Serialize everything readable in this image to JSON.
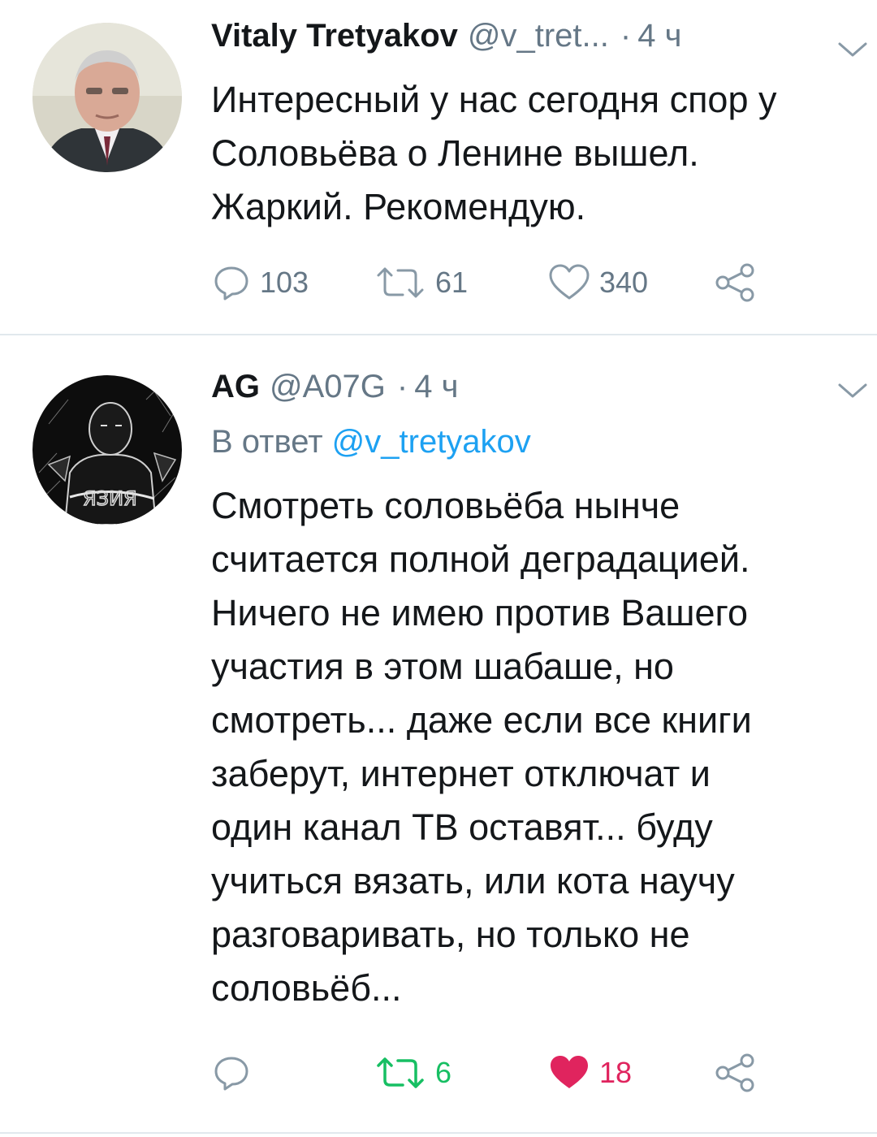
{
  "colors": {
    "text": "#14171a",
    "secondary": "#657786",
    "link": "#1da1f2",
    "retweet_active": "#17bf63",
    "like_active": "#e0245e",
    "divider": "#e1e8ed"
  },
  "tweets": [
    {
      "author_name": "Vitaly Tretyakov",
      "handle": "@v_tret...",
      "dot": "·",
      "time": "4 ч",
      "body_lines": [
        "Интересный у нас сегодня спор у",
        "Соловьёва о Ленине вышел.",
        "Жаркий. Рекомендую."
      ],
      "replies": "103",
      "retweets": "61",
      "likes": "340",
      "retweeted": false,
      "liked": false,
      "icons": [
        "reply-icon",
        "retweet-icon",
        "heart-icon",
        "share-icon",
        "chevron-down-icon"
      ]
    },
    {
      "author_name": "AG",
      "handle": "@A07G",
      "dot": "·",
      "time": "4 ч",
      "reply_prefix": "В ответ",
      "reply_handle": "@v_tretyakov",
      "body_lines": [
        "Смотреть соловьёба нынче",
        "считается полной деградацией.",
        "Ничего не имею против Вашего",
        "участия в этом шабаше, но",
        "смотреть... даже если все книги",
        "заберут, интернет отключат и",
        "один канал ТВ оставят... буду",
        "учиться вязать, или кота научу",
        "разговаривать, но только не",
        "соловьёб..."
      ],
      "replies": "",
      "retweets": "6",
      "likes": "18",
      "retweeted": true,
      "liked": true,
      "icons": [
        "reply-icon",
        "retweet-icon",
        "heart-filled-icon",
        "share-icon",
        "chevron-down-icon"
      ]
    }
  ]
}
